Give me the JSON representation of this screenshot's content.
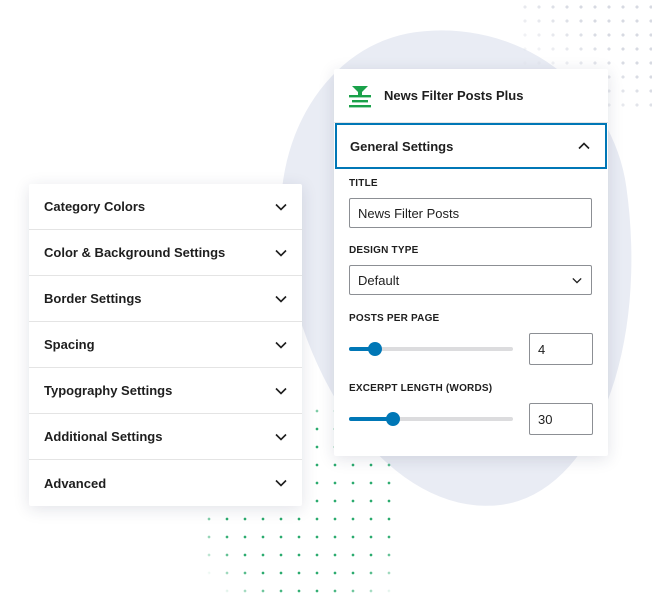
{
  "left_panel": {
    "items": [
      {
        "label": "Category Colors"
      },
      {
        "label": "Color & Background Settings"
      },
      {
        "label": "Border Settings"
      },
      {
        "label": "Spacing"
      },
      {
        "label": "Typography Settings"
      },
      {
        "label": "Additional Settings"
      },
      {
        "label": "Advanced"
      }
    ]
  },
  "plugin": {
    "title": "News Filter Posts Plus",
    "logo_icon": "filter-funnel-icon",
    "accent": "#1aa14a"
  },
  "general_settings": {
    "heading": "General Settings",
    "expanded": true,
    "accent": "#0077b6",
    "title_label": "TITLE",
    "title_value": "News Filter Posts",
    "design_type_label": "DESIGN TYPE",
    "design_type_value": "Default",
    "posts_per_page_label": "POSTS PER PAGE",
    "posts_per_page_value": "4",
    "posts_per_page_slider_fraction": 0.16,
    "excerpt_length_label": "EXCERPT LENGTH (WORDS)",
    "excerpt_length_value": "30",
    "excerpt_length_slider_fraction": 0.27
  }
}
